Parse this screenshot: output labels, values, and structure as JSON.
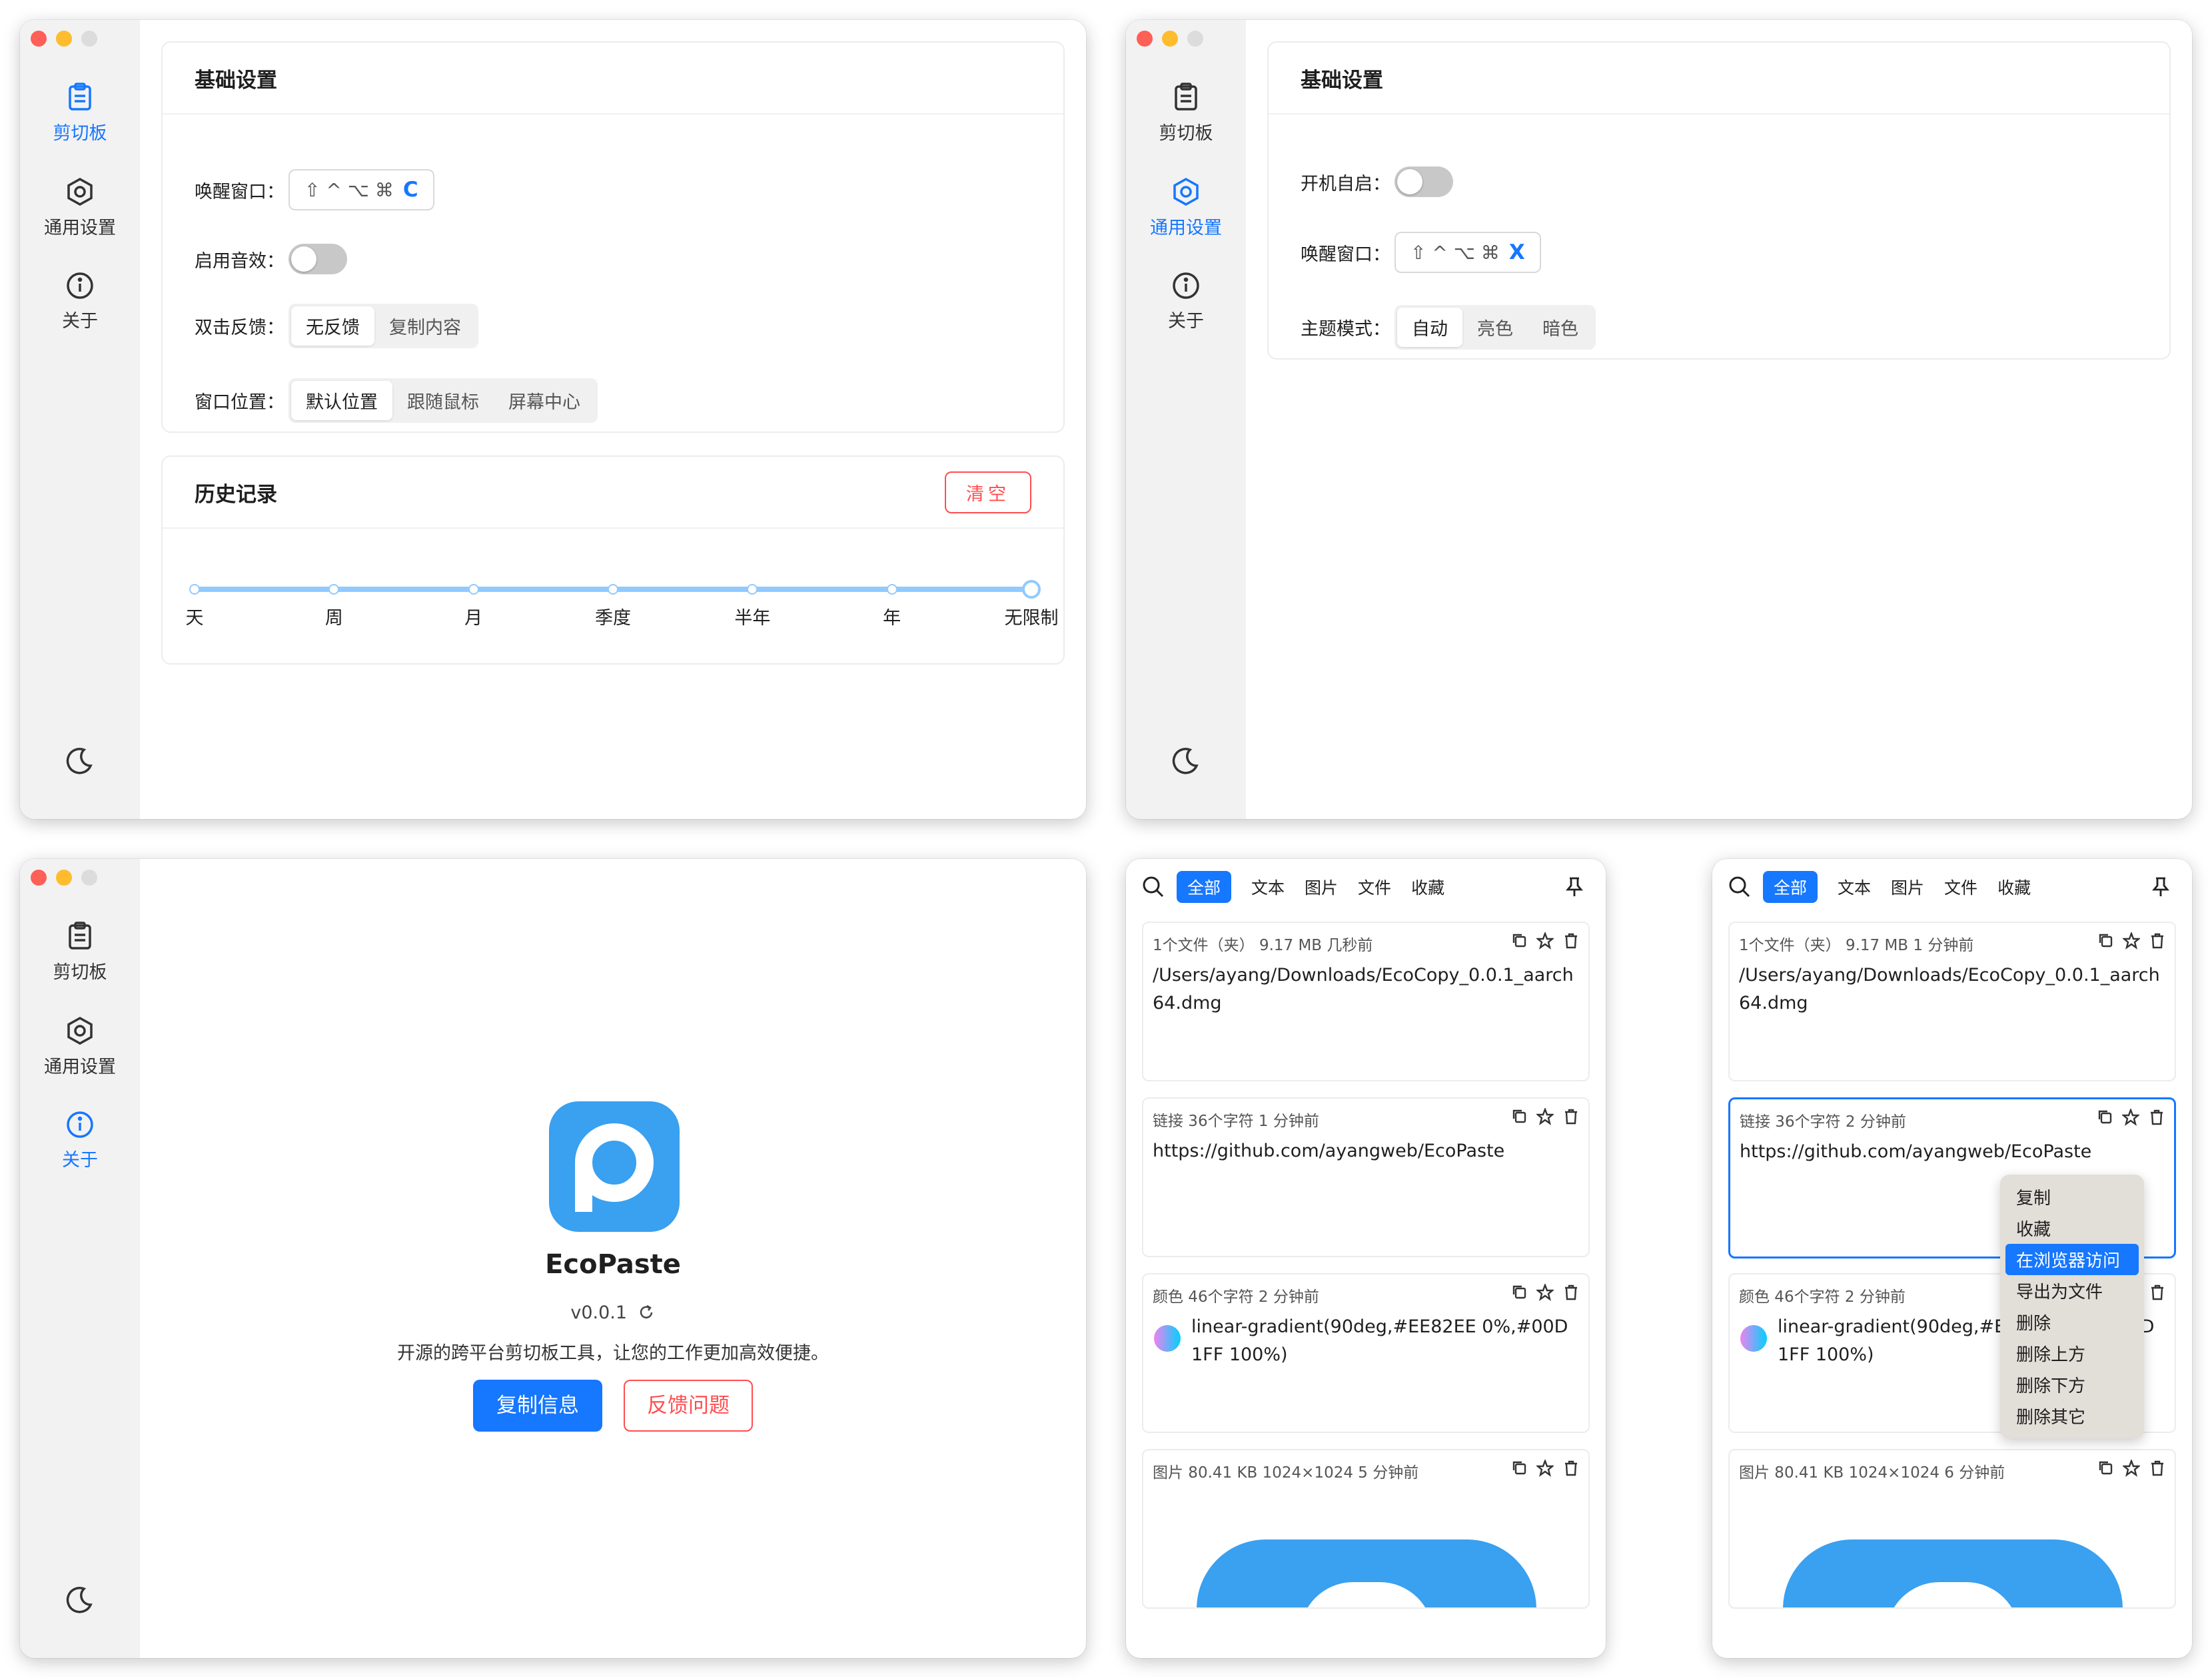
{
  "nav": {
    "clipboard": "剪切板",
    "general": "通用设置",
    "about": "关于"
  },
  "clipboard_settings": {
    "basic_title": "基础设置",
    "wake_label": "唤醒窗口：",
    "wake_mods": "⇧ ^ ⌥ ⌘",
    "wake_key": "C",
    "sound_label": "启用音效：",
    "dblclick_label": "双击反馈：",
    "dblclick_options": [
      "无反馈",
      "复制内容"
    ],
    "position_label": "窗口位置：",
    "position_options": [
      "默认位置",
      "跟随鼠标",
      "屏幕中心"
    ],
    "history_title": "历史记录",
    "clear_label": "清空",
    "history_marks": [
      "天",
      "周",
      "月",
      "季度",
      "半年",
      "年",
      "无限制"
    ]
  },
  "general_settings": {
    "basic_title": "基础设置",
    "autostart_label": "开机自启：",
    "wake_label": "唤醒窗口：",
    "wake_mods": "⇧ ^ ⌥ ⌘",
    "wake_key": "X",
    "theme_label": "主题模式：",
    "theme_options": [
      "自动",
      "亮色",
      "暗色"
    ]
  },
  "about": {
    "app_name": "EcoPaste",
    "version": "v0.0.1",
    "description": "开源的跨平台剪切板工具，让您的工作更加高效便捷。",
    "copy_info": "复制信息",
    "feedback": "反馈问题"
  },
  "panel": {
    "tabs": [
      "全部",
      "文本",
      "图片",
      "文件",
      "收藏"
    ]
  },
  "panel_left": {
    "items": [
      {
        "meta": "1个文件（夹） 9.17 MB 几秒前",
        "body": "/Users/ayang/Downloads/EcoCopy_0.0.1_aarch64.dmg"
      },
      {
        "meta": "链接  36个字符  1 分钟前",
        "body": "https://github.com/ayangweb/EcoPaste"
      },
      {
        "meta": "颜色  46个字符  2 分钟前",
        "body": "linear-gradient(90deg,#EE82EE 0%,#00D1FF 100%)"
      },
      {
        "meta": "图片  80.41 KB  1024×1024  5 分钟前",
        "body": ""
      }
    ]
  },
  "panel_right": {
    "items": [
      {
        "meta": "1个文件（夹） 9.17 MB 1 分钟前",
        "body": "/Users/ayang/Downloads/EcoCopy_0.0.1_aarch64.dmg"
      },
      {
        "meta": "链接  36个字符  2 分钟前",
        "body": "https://github.com/ayangweb/EcoPaste"
      },
      {
        "meta": "颜色  46个字符  2 分钟前",
        "body": "linear-gradient(90deg,#EE82EE 0%,#00D1FF 100%)"
      },
      {
        "meta": "图片  80.41 KB  1024×1024  6 分钟前",
        "body": ""
      }
    ],
    "context_menu": [
      "复制",
      "收藏",
      "在浏览器访问",
      "导出为文件",
      "删除",
      "删除上方",
      "删除下方",
      "删除其它"
    ]
  },
  "colors": {
    "accent": "#1677ff",
    "danger": "#ff4d4f",
    "logo": "#3aa0f0"
  }
}
